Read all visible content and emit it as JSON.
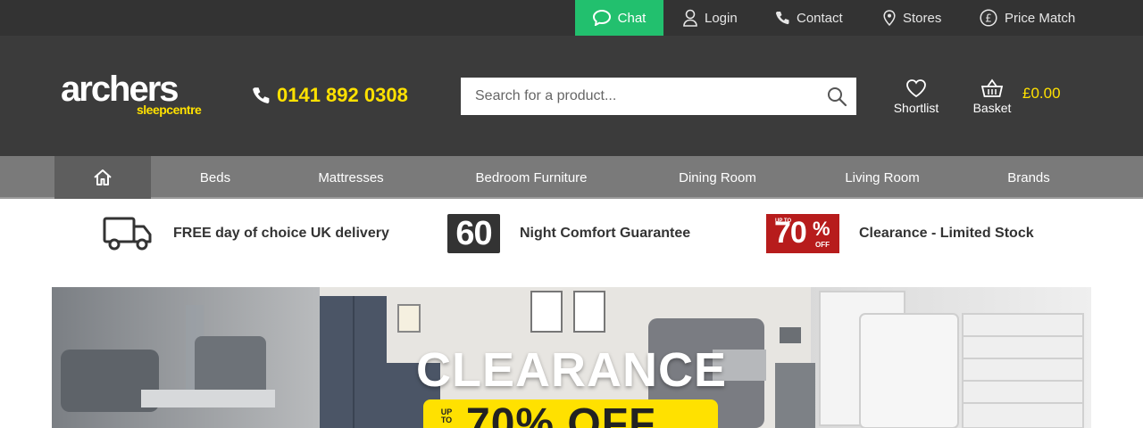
{
  "topbar": {
    "chat": "Chat",
    "login": "Login",
    "contact": "Contact",
    "stores": "Stores",
    "price_match": "Price Match"
  },
  "header": {
    "logo_main": "archers",
    "logo_sub": "sleepcentre",
    "phone": "0141 892 0308",
    "search_placeholder": "Search for a product...",
    "shortlist": "Shortlist",
    "basket": "Basket",
    "basket_total": "£0.00"
  },
  "nav": {
    "items": [
      "Beds",
      "Mattresses",
      "Bedroom Furniture",
      "Dining Room",
      "Living Room",
      "Brands"
    ]
  },
  "usps": {
    "delivery": "FREE day of choice UK delivery",
    "comfort_badge": "60",
    "comfort": "Night Comfort Guarantee",
    "clearance_badge_upto": "UP TO",
    "clearance_badge_value": "70",
    "clearance_badge_pct": "%",
    "clearance_badge_off": "OFF",
    "clearance": "Clearance - Limited Stock"
  },
  "banner": {
    "title": "CLEARANCE",
    "upto": "UP TO",
    "offer": "70% OFF"
  },
  "colors": {
    "accent_yellow": "#ffe100",
    "chat_green": "#22c06e",
    "header_dark": "#3b3b3b",
    "topbar_dark": "#333333",
    "nav_grey": "#7a7a7a",
    "clearance_red": "#b71c1c"
  }
}
